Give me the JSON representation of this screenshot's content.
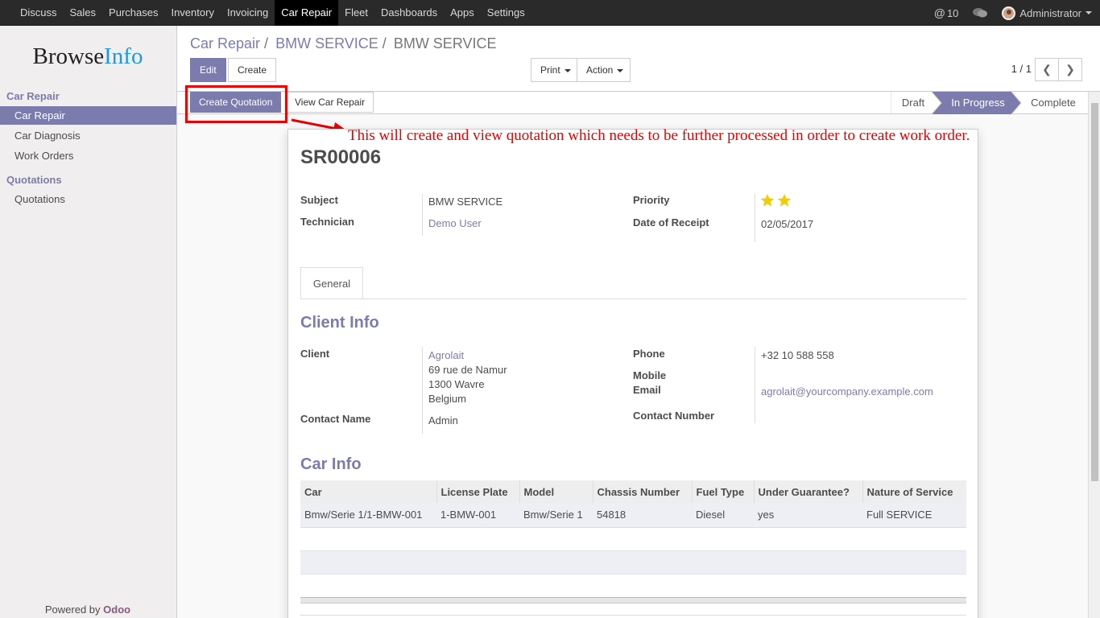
{
  "topbar": {
    "menu": [
      "Discuss",
      "Sales",
      "Purchases",
      "Inventory",
      "Invoicing",
      "Car Repair",
      "Fleet",
      "Dashboards",
      "Apps",
      "Settings"
    ],
    "active_index": 5,
    "mentions_count": "10",
    "user": "Administrator"
  },
  "sidebar": {
    "logo_left": "Browse",
    "logo_right": "Info",
    "sections": [
      {
        "title": "Car Repair",
        "items": [
          "Car Repair",
          "Car Diagnosis",
          "Work Orders"
        ]
      },
      {
        "title": "Quotations",
        "items": [
          "Quotations"
        ]
      }
    ],
    "powered_by": "Powered by",
    "powered_brand": "Odoo"
  },
  "breadcrumb": {
    "items": [
      "Car Repair",
      "BMW SERVICE"
    ],
    "current": "BMW SERVICE",
    "sep": "/"
  },
  "control": {
    "edit": "Edit",
    "create": "Create",
    "print": "Print",
    "action": "Action",
    "pager": "1 / 1"
  },
  "statusbar": {
    "create_quotation": "Create Quotation",
    "view_car_repair": "View Car Repair",
    "stages": [
      "Draft",
      "In Progress",
      "Complete"
    ],
    "current_stage": "In Progress"
  },
  "annotation": "This will create and view quotation which needs to be further processed in order to create work order.",
  "record": {
    "reference": "SR00006",
    "subject_label": "Subject",
    "subject": "BMW SERVICE",
    "technician_label": "Technician",
    "technician": "Demo User",
    "priority_label": "Priority",
    "priority_stars": 2,
    "date_label": "Date of Receipt",
    "date": "02/05/2017"
  },
  "tabs": [
    "General"
  ],
  "client_info": {
    "heading": "Client Info",
    "client_label": "Client",
    "client_name": "Agrolait",
    "address": [
      "69 rue de Namur",
      "1300 Wavre",
      "Belgium"
    ],
    "contact_name_label": "Contact Name",
    "contact_name": "Admin",
    "phone_label": "Phone",
    "phone": "+32 10 588 558",
    "mobile_label": "Mobile",
    "email_label": "Email",
    "email": "agrolait@yourcompany.example.com",
    "contact_number_label": "Contact Number"
  },
  "car_info": {
    "heading": "Car Info",
    "columns": [
      "Car",
      "License Plate",
      "Model",
      "Chassis Number",
      "Fuel Type",
      "Under Guarantee?",
      "Nature of Service"
    ],
    "rows": [
      [
        "Bmw/Serie 1/1-BMW-001",
        "1-BMW-001",
        "Bmw/Serie 1",
        "54818",
        "Diesel",
        "yes",
        "Full SERVICE"
      ]
    ]
  },
  "colors": {
    "brand": "#7c7bad",
    "highlight": "#e60000",
    "star": "#f3cc00"
  }
}
